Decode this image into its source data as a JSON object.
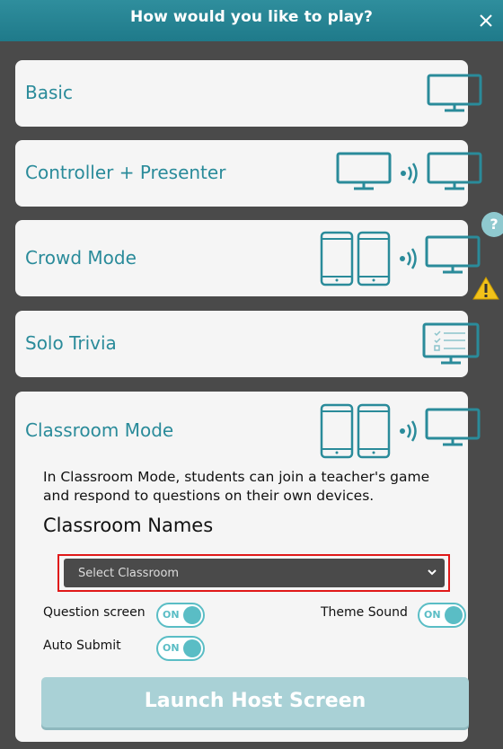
{
  "dialog": {
    "title": "How would you like to play?"
  },
  "modes": [
    {
      "label": "Basic"
    },
    {
      "label": "Controller + Presenter"
    },
    {
      "label": "Crowd Mode"
    },
    {
      "label": "Solo Trivia"
    },
    {
      "label": "Classroom Mode"
    }
  ],
  "help_badge": "?",
  "classroom": {
    "description_line1": "In Classroom Mode, students can join a teacher's game",
    "description_line2": "and respond to questions on their own devices.",
    "names_title": "Classroom Names",
    "select_value": "Select Classroom",
    "question_screen_label": "Question screen",
    "question_screen_toggle": "ON",
    "theme_sound_label": "Theme Sound",
    "theme_sound_toggle": "ON",
    "auto_submit_label": "Auto Submit",
    "auto_submit_toggle": "ON",
    "launch_label": "Launch Host Screen"
  },
  "icons": [
    "close-icon",
    "monitor-icon",
    "wireless-icon",
    "phone-icon",
    "checklist-monitor-icon",
    "warning-icon",
    "chevron-down-icon"
  ],
  "colors": {
    "accent": "#2a8b9a",
    "header": "#2a8797",
    "toggle": "#5abdc5",
    "launch_button": "#a9d1d6",
    "highlight": "#e01919"
  }
}
